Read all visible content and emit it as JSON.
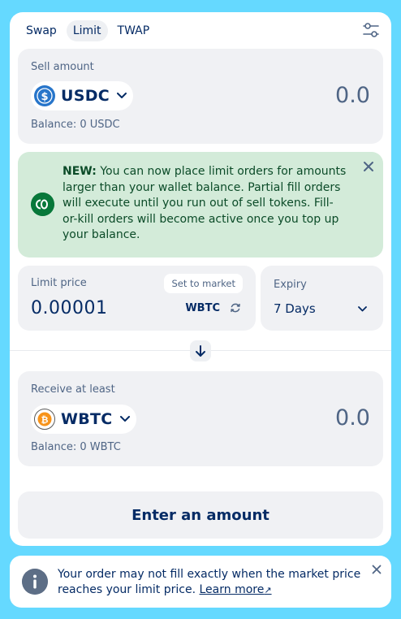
{
  "tabs": [
    {
      "label": "Swap",
      "active": false
    },
    {
      "label": "Limit",
      "active": true
    },
    {
      "label": "TWAP",
      "active": false
    }
  ],
  "sell": {
    "label": "Sell amount",
    "token": "USDC",
    "amount": "0.0",
    "balance_label": "Balance:",
    "balance_value": "0 USDC",
    "token_color": "#2775ca"
  },
  "notice": {
    "bold": "NEW:",
    "text": " You can now place limit orders for amounts larger than your wallet balance. Partial fill orders will execute until you run out of sell tokens. Fill-or-kill orders will become active once you top up your balance."
  },
  "limit_price": {
    "label": "Limit price",
    "set_to_market": "Set to market",
    "value": "0.00001",
    "unit": "WBTC"
  },
  "expiry": {
    "label": "Expiry",
    "value": "7 Days"
  },
  "receive": {
    "label": "Receive at least",
    "token": "WBTC",
    "amount": "0.0",
    "balance_label": "Balance:",
    "balance_value": "0 WBTC",
    "token_color": "#f7931a"
  },
  "cta_label": "Enter an amount",
  "info": {
    "text": "Your order may not fill exactly when the market price reaches your limit price. ",
    "link": "Learn more",
    "link_arrow": "↗"
  },
  "colors": {
    "background": "#65d9ff",
    "primary_text": "#052b65",
    "notice_bg": "#d3ebd9",
    "notice_text": "#0b4b28"
  }
}
